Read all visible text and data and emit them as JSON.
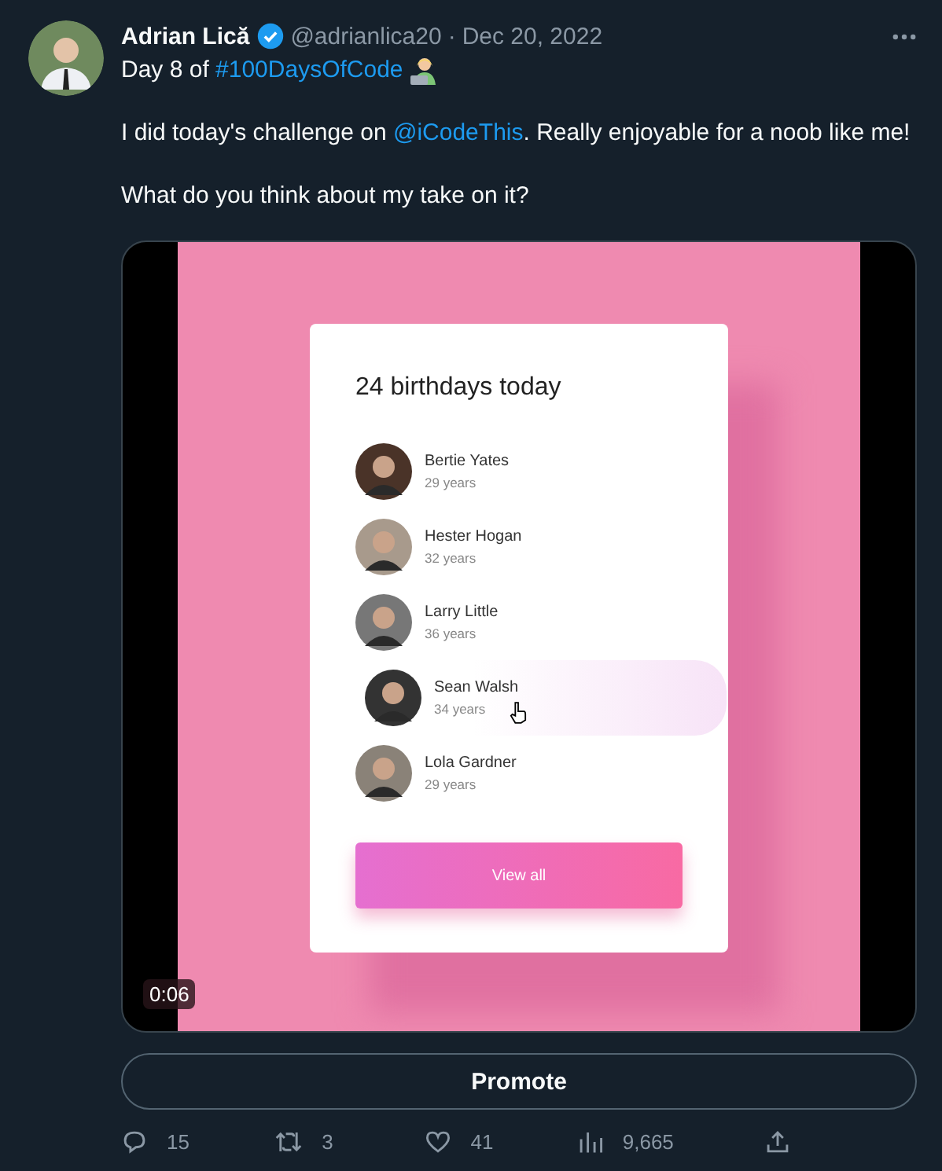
{
  "tweet": {
    "author": "Adrian Lică",
    "verified": true,
    "handle": "@adrianlica20",
    "separator": "·",
    "date": "Dec 20, 2022",
    "line1": [
      {
        "kind": "text",
        "text": "Day 8 of "
      },
      {
        "kind": "hashtag",
        "text": "#100DaysOfCode"
      }
    ],
    "line2": [
      {
        "kind": "text",
        "text": "I did today's challenge on "
      },
      {
        "kind": "mention",
        "text": "@iCodeThis"
      },
      {
        "kind": "text",
        "text": ". Really enjoyable for a noob like me!"
      }
    ],
    "line3": "What do you think about my take on it?"
  },
  "video": {
    "duration": "0:06",
    "card": {
      "title": "24 birthdays today",
      "people": [
        {
          "name": "Bertie Yates",
          "age": "29 years",
          "selected": false
        },
        {
          "name": "Hester Hogan",
          "age": "32 years",
          "selected": false
        },
        {
          "name": "Larry Little",
          "age": "36 years",
          "selected": false
        },
        {
          "name": "Sean Walsh",
          "age": "34 years",
          "selected": true
        },
        {
          "name": "Lola Gardner",
          "age": "29 years",
          "selected": false
        }
      ],
      "button": "View all"
    }
  },
  "promote": "Promote",
  "actions": [
    {
      "kind": "reply",
      "count": "15"
    },
    {
      "kind": "retweet",
      "count": "3"
    },
    {
      "kind": "like",
      "count": "41"
    },
    {
      "kind": "views",
      "count": "9,665"
    },
    {
      "kind": "share"
    }
  ]
}
